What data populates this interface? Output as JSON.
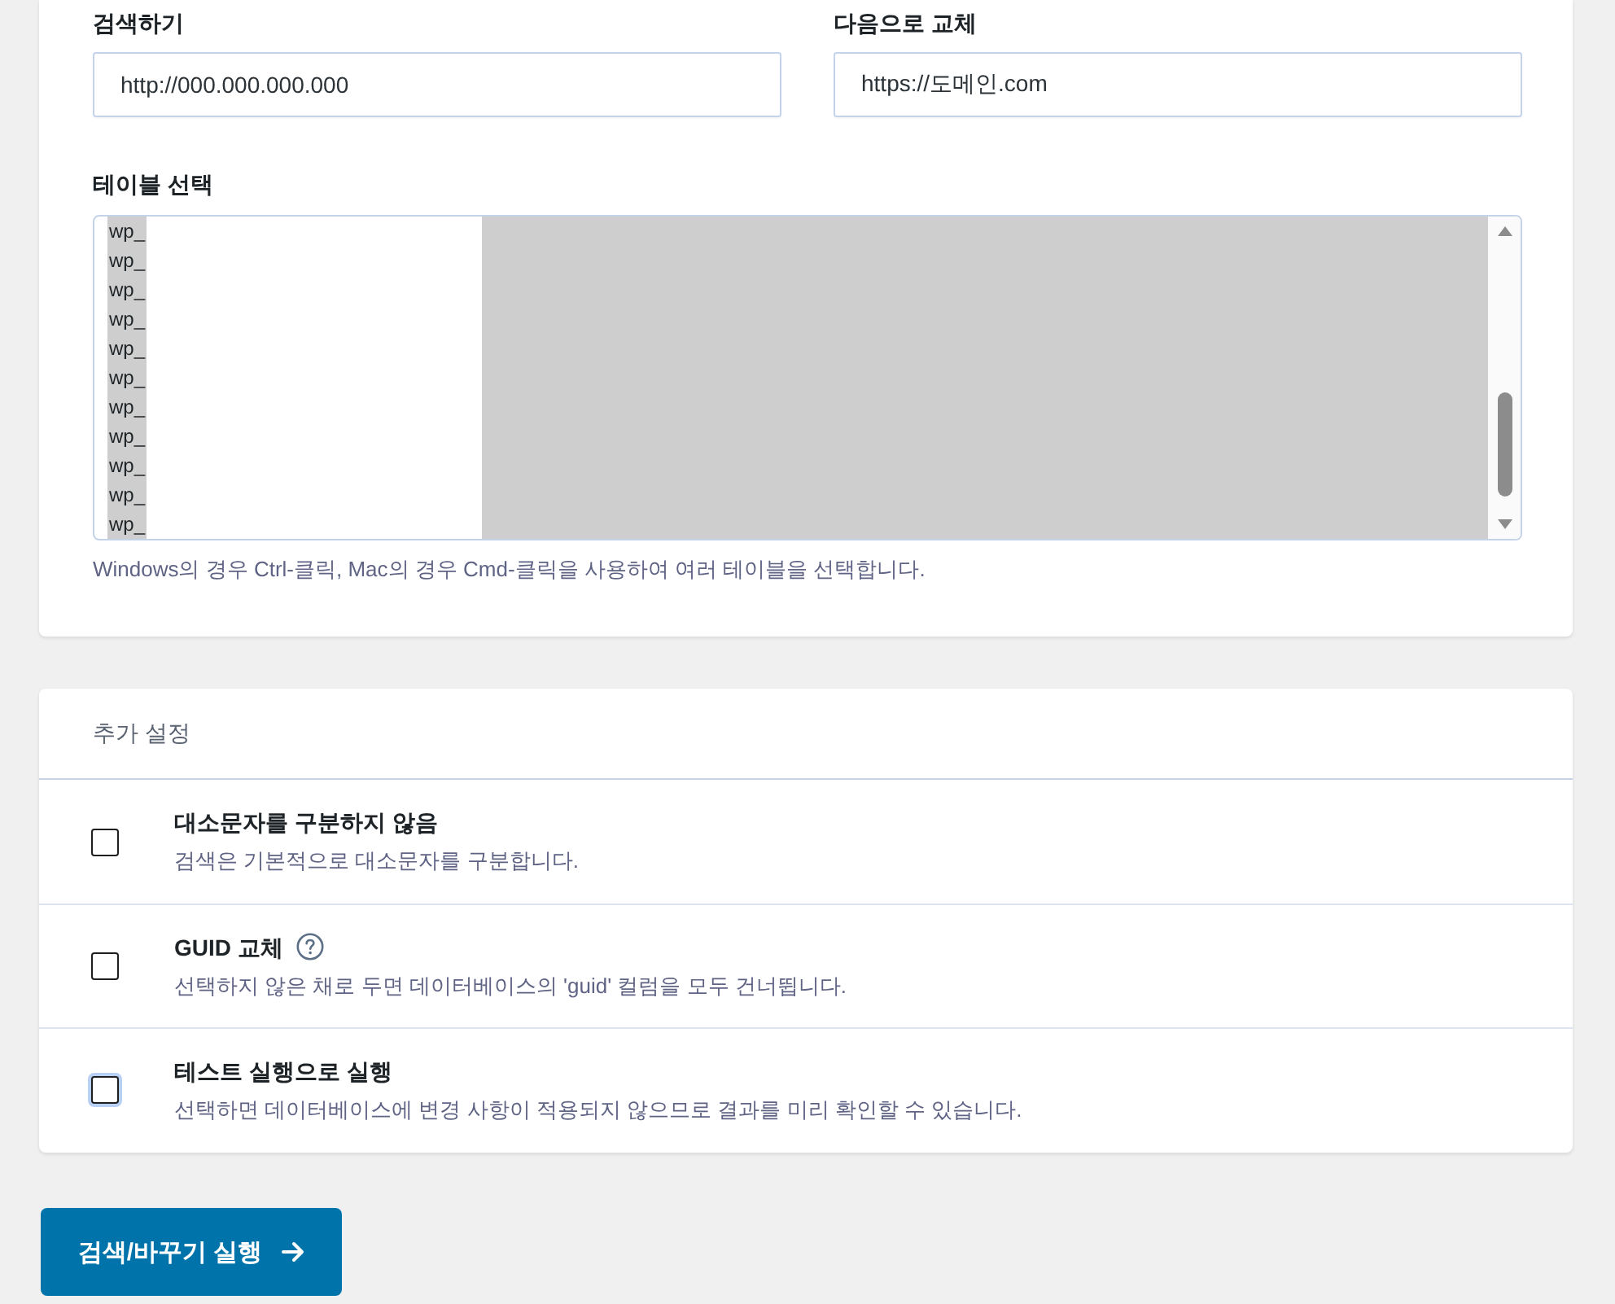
{
  "search_replace": {
    "search_label": "검색하기",
    "search_value": "http://000.000.000.000",
    "replace_label": "다음으로 교체",
    "replace_value": "https://도메인.com"
  },
  "table_select": {
    "label": "테이블 선택",
    "options": [
      {
        "text": "wp_",
        "selected": true
      },
      {
        "text": "wp_",
        "selected": true
      },
      {
        "text": "wp_",
        "selected": true
      },
      {
        "text": "wp_",
        "selected": true
      },
      {
        "text": "wp_",
        "selected": true
      },
      {
        "text": "wp_",
        "selected": true
      },
      {
        "text": "wp_",
        "selected": true
      },
      {
        "text": "wp_",
        "selected": true
      },
      {
        "text": "wp_",
        "selected": true
      },
      {
        "text": "wp_",
        "selected": true
      },
      {
        "text": "wp_",
        "selected": true
      }
    ],
    "help": "Windows의 경우 Ctrl-클릭, Mac의 경우 Cmd-클릭을 사용하여 여러 테이블을 선택합니다."
  },
  "additional_settings": {
    "title": "추가 설정",
    "options": [
      {
        "title": "대소문자를 구분하지 않음",
        "description": "검색은 기본적으로 대소문자를 구분합니다.",
        "checked": false,
        "focused": false,
        "help_icon": false
      },
      {
        "title": "GUID 교체",
        "description": "선택하지 않은 채로 두면 데이터베이스의 'guid' 컬럼을 모두 건너뜁니다.",
        "checked": false,
        "focused": false,
        "help_icon": true
      },
      {
        "title": "테스트 실행으로 실행",
        "description": "선택하면 데이터베이스에 변경 사항이 적용되지 않으므로 결과를 미리 확인할 수 있습니다.",
        "checked": false,
        "focused": true,
        "help_icon": false
      }
    ]
  },
  "submit_button": {
    "label": "검색/바꾸기 실행"
  }
}
